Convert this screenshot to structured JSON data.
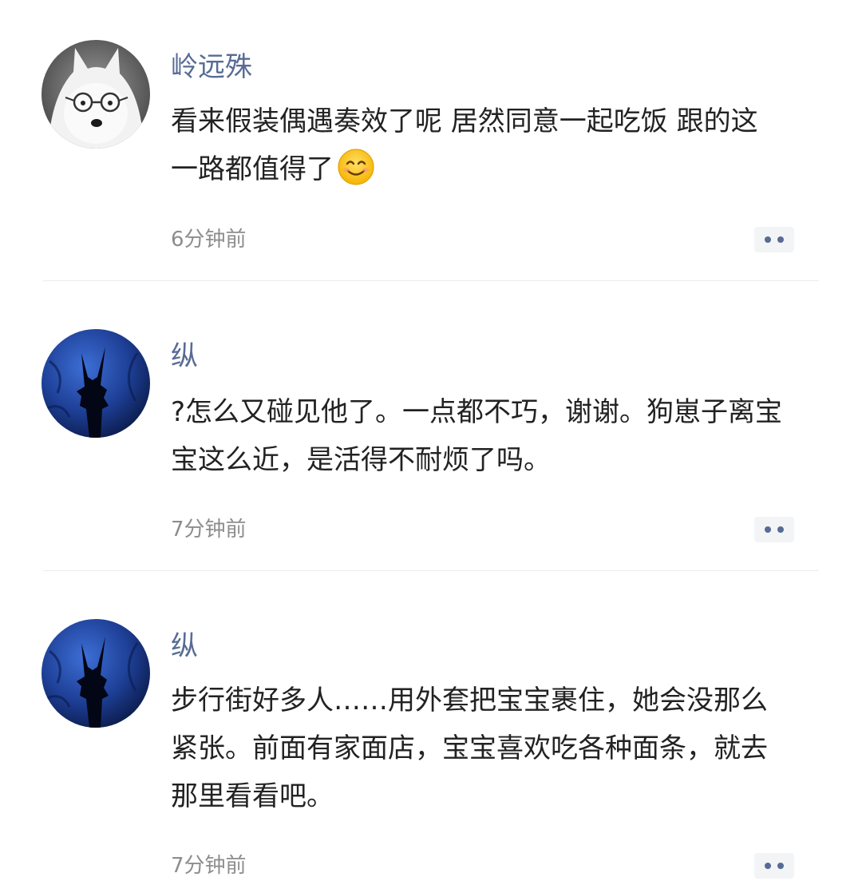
{
  "comments": [
    {
      "username": "岭远殊",
      "avatar_icon": "samoyed-dog-with-glasses-avatar",
      "lines": [
        "看来假装偶遇奏效了呢  居然同意一起吃饭  跟的这",
        "一路都值得了"
      ],
      "emoji_icon": "smiling-face-emoji",
      "time": "6分钟前",
      "more_icon": "more-dots-icon"
    },
    {
      "username": "纵",
      "avatar_icon": "dark-blue-night-silhouette-avatar",
      "lines": [
        "?怎么又碰见他了。一点都不巧，谢谢。狗崽子离宝",
        "宝这么近，是活得不耐烦了吗。"
      ],
      "time": "7分钟前",
      "more_icon": "more-dots-icon"
    },
    {
      "username": "纵",
      "avatar_icon": "dark-blue-night-silhouette-avatar",
      "lines": [
        "步行街好多人……用外套把宝宝裹住，她会没那么",
        "紧张。前面有家面店，宝宝喜欢吃各种面条，就去",
        "那里看看吧。"
      ],
      "time": "7分钟前",
      "more_icon": "more-dots-icon"
    }
  ],
  "colors": {
    "username": "#576b95",
    "text": "#222222",
    "time": "#8d8d8d",
    "divider": "#ececec",
    "more_button_bg": "#f3f4f6"
  }
}
